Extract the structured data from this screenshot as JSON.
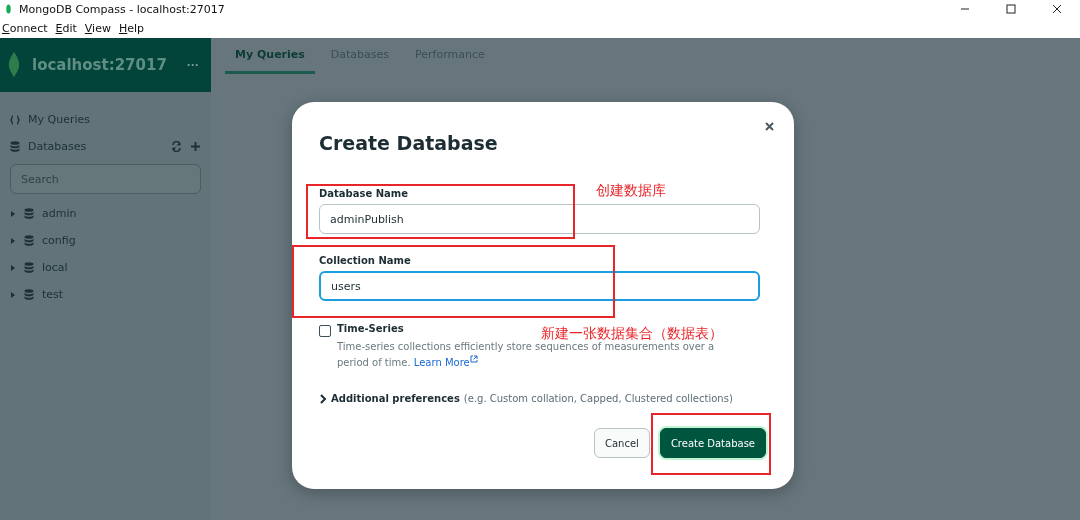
{
  "window": {
    "title": "MongoDB Compass - localhost:27017"
  },
  "menu": [
    "Connect",
    "Edit",
    "View",
    "Help"
  ],
  "connection": {
    "name": "localhost:27017",
    "more": "···"
  },
  "tabs": [
    {
      "label": "My Queries",
      "selected": true
    },
    {
      "label": "Databases",
      "selected": false
    },
    {
      "label": "Performance",
      "selected": false
    }
  ],
  "sidebar": {
    "my_queries": "My Queries",
    "databases_label": "Databases",
    "search": {
      "placeholder": "Search"
    },
    "databases": [
      {
        "name": "admin",
        "expanded": false
      },
      {
        "name": "config",
        "expanded": false
      },
      {
        "name": "local",
        "expanded": false
      },
      {
        "name": "test",
        "expanded": false
      }
    ]
  },
  "dialog": {
    "title": "Create Database",
    "fields": [
      {
        "label": "Database Name",
        "value": "adminPublish",
        "focused": false
      },
      {
        "label": "Collection Name",
        "value": "users",
        "focused": true
      }
    ],
    "time_series": {
      "label": "Time-Series",
      "checked": false,
      "description": "Time-series collections efficiently store sequences of measurements over a period of time.",
      "link": "Learn More"
    },
    "additional": {
      "label": "Additional preferences",
      "hint": "(e.g. Custom collation, Capped, Clustered collections)",
      "expanded": false
    },
    "buttons": [
      {
        "label": "Cancel",
        "kind": "secondary"
      },
      {
        "label": "Create Database",
        "kind": "primary"
      }
    ]
  },
  "annotations": [
    "创建数据库",
    "新建一张数据集合（数据表）"
  ]
}
